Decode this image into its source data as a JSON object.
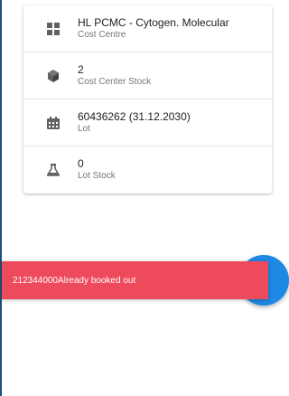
{
  "details": {
    "rows": [
      {
        "icon": "grid-icon",
        "value": "HL PCMC - Cytogen. Molecular",
        "label": "Cost Centre"
      },
      {
        "icon": "cube-icon",
        "value": "2",
        "label": "Cost Center Stock"
      },
      {
        "icon": "calendar-icon",
        "value": "60436262 (31.12.2030)",
        "label": "Lot"
      },
      {
        "icon": "flask-icon",
        "value": "0",
        "label": "Lot Stock"
      }
    ]
  },
  "snackbar": {
    "message": "212344000Already booked out",
    "color": "#ed4a5c"
  },
  "fab": {
    "color": "#1e88e5"
  }
}
